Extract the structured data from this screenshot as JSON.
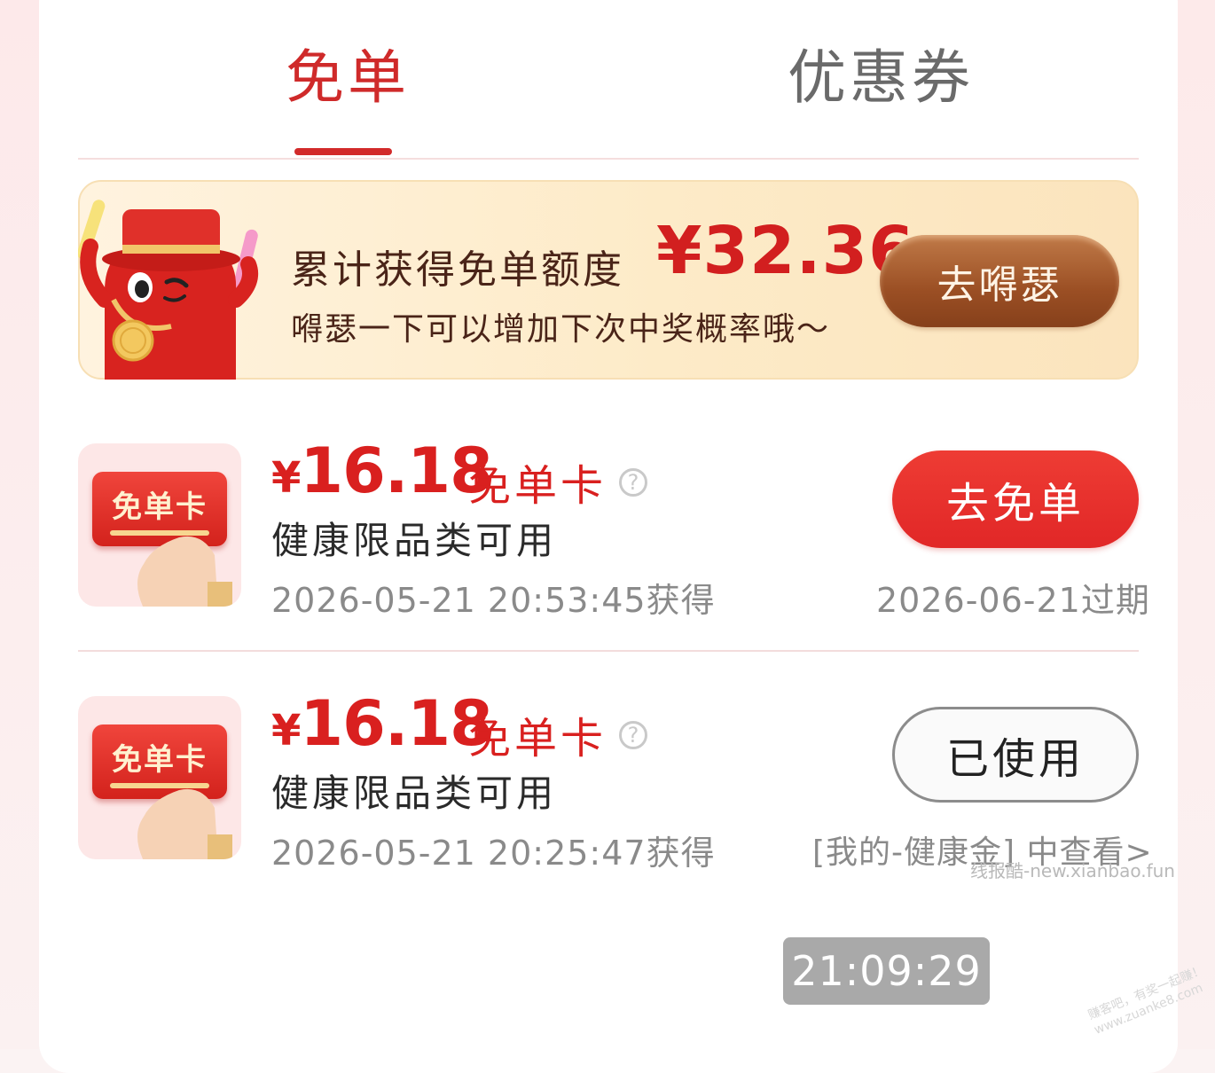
{
  "tabs": [
    {
      "label": "免单",
      "active": true
    },
    {
      "label": "优惠券",
      "active": false
    }
  ],
  "banner": {
    "title": "累计获得免单额度",
    "amount": "¥32.36",
    "subtitle": "嘚瑟一下可以增加下次中奖概率哦～",
    "button_label": "去嘚瑟"
  },
  "items": [
    {
      "thumb_label": "免单卡",
      "price_symbol": "¥",
      "price_value": "16.18",
      "card_type": "免单卡",
      "help_glyph": "?",
      "description": "健康限品类可用",
      "obtained_time": "2026-05-21 20:53:45获得",
      "button_label": "去免单",
      "expire_text": "2026-06-21过期"
    },
    {
      "thumb_label": "免单卡",
      "price_symbol": "¥",
      "price_value": "16.18",
      "card_type": "免单卡",
      "help_glyph": "?",
      "description": "健康限品类可用",
      "obtained_time": "2026-05-21 20:25:47获得",
      "button_label": "已使用",
      "link_text": "[我的-健康金] 中查看>"
    }
  ],
  "overlay": {
    "watermark": "线报酷-new.xianbao.fun",
    "corner_stamp_line1": "赚客吧，有奖一起赚！",
    "corner_stamp_line2": "www.zuanke8.com",
    "time": "21:09:29"
  },
  "colors": {
    "accent_red": "#d9201f",
    "tab_active": "#cf2a2a",
    "tab_inactive": "#6a6a6a",
    "banner_button": "#9b4f24"
  },
  "icons": {
    "help": "help-circle-icon",
    "mascot": "mascot-illustration",
    "thumb": "free-card-hand-illustration"
  }
}
